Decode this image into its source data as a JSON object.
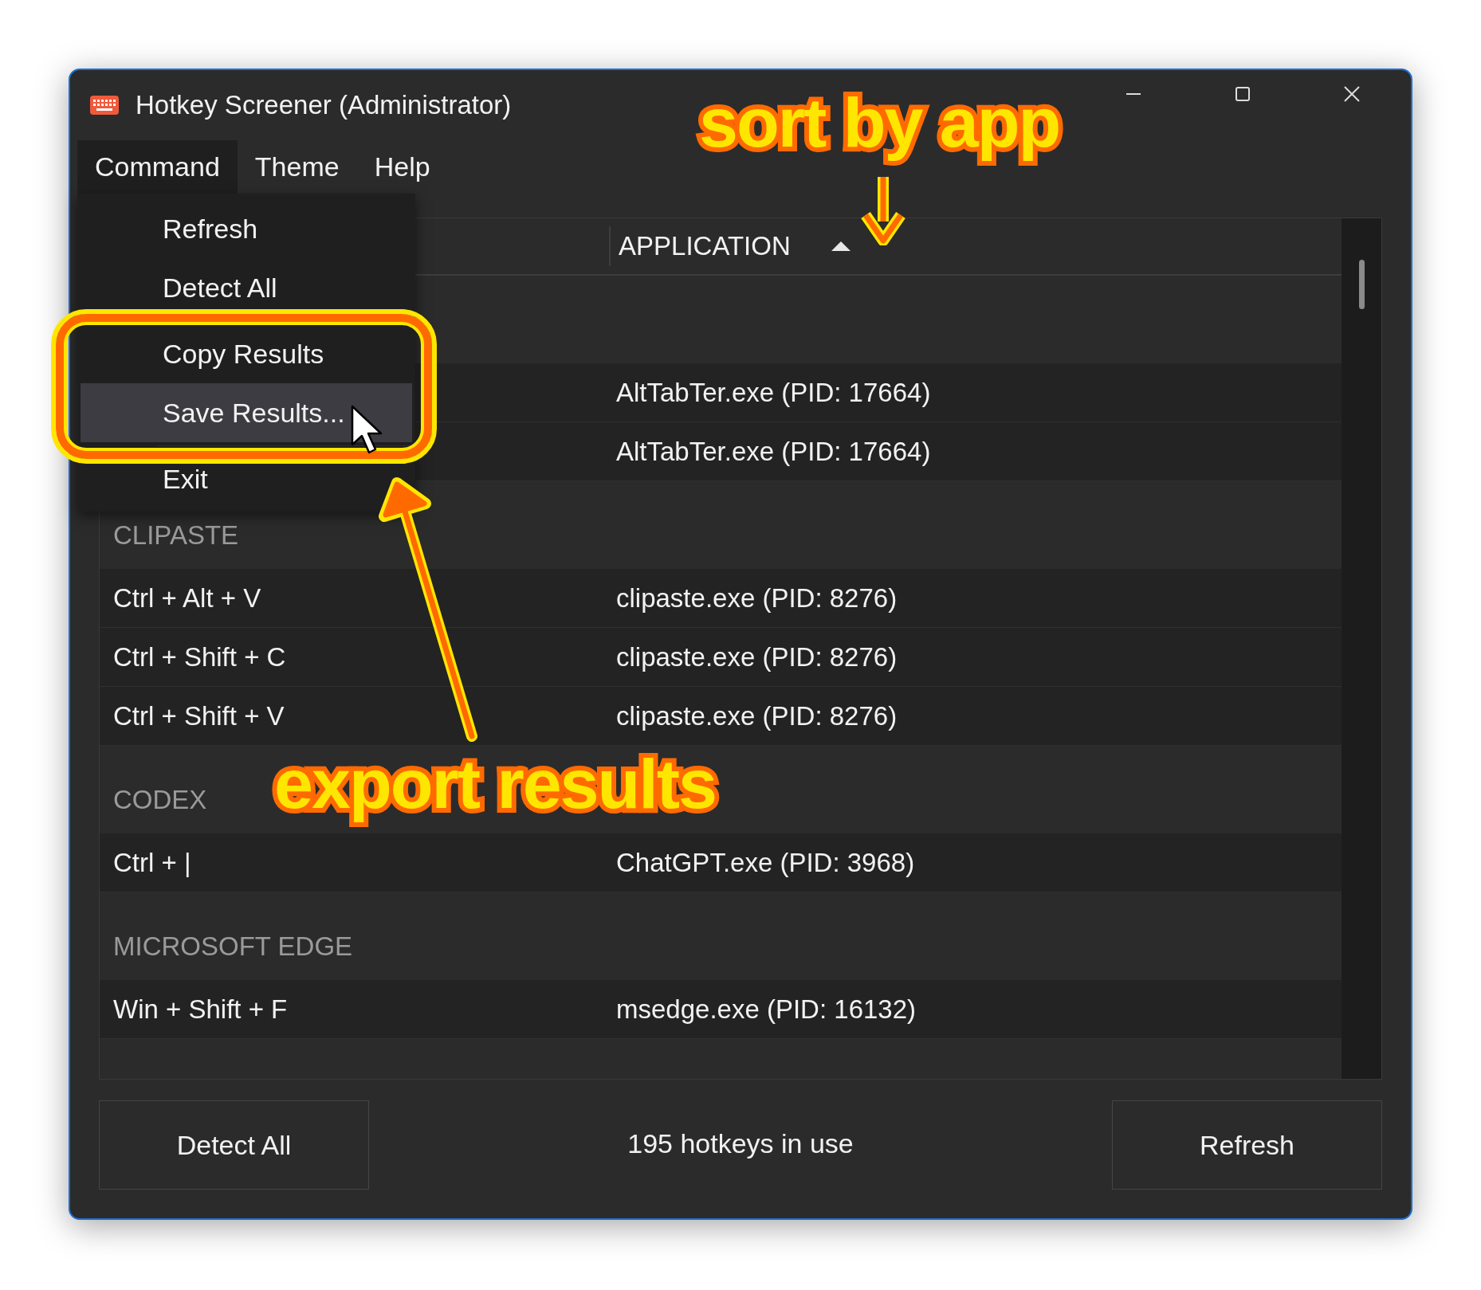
{
  "window": {
    "title": "Hotkey Screener (Administrator)"
  },
  "menu_bar": [
    {
      "label": "Command",
      "selected": true
    },
    {
      "label": "Theme",
      "selected": false
    },
    {
      "label": "Help",
      "selected": false
    }
  ],
  "command_menu": [
    {
      "kind": "item",
      "label": "Refresh",
      "selected": false
    },
    {
      "kind": "item",
      "label": "Detect All",
      "selected": false
    },
    {
      "kind": "separator"
    },
    {
      "kind": "item",
      "label": "Copy Results",
      "selected": false
    },
    {
      "kind": "item",
      "label": "Save Results...",
      "selected": true
    },
    {
      "kind": "separator"
    },
    {
      "kind": "item",
      "label": "Exit",
      "selected": false
    }
  ],
  "table": {
    "columns": [
      {
        "label": "APPLICATION",
        "sort_ascending": true
      }
    ],
    "groups": [
      {
        "rows": [
          {
            "application": "AltTabTer.exe (PID: 17664)"
          },
          {
            "application": "AltTabTer.exe (PID: 17664)"
          }
        ]
      },
      {
        "name": "CLIPASTE",
        "rows": [
          {
            "hotkey": "Ctrl + Alt + V",
            "application": "clipaste.exe (PID: 8276)"
          },
          {
            "hotkey": "Ctrl + Shift + C",
            "application": "clipaste.exe (PID: 8276)"
          },
          {
            "hotkey": "Ctrl + Shift + V",
            "application": "clipaste.exe (PID: 8276)"
          }
        ]
      },
      {
        "name": "CODEX",
        "rows": [
          {
            "hotkey": "Ctrl + |",
            "application": "ChatGPT.exe (PID: 3968)"
          }
        ]
      },
      {
        "name": "MICROSOFT EDGE",
        "rows": [
          {
            "hotkey": "Win + Shift + F",
            "application": "msedge.exe (PID: 16132)"
          }
        ]
      }
    ]
  },
  "footer": {
    "buttons": [
      "Detect All",
      "Refresh"
    ],
    "status": "195 hotkeys in use"
  },
  "annotations": [
    {
      "kind": "sort-note",
      "text": "sort by app"
    },
    {
      "kind": "export-note",
      "text": "export results"
    }
  ]
}
